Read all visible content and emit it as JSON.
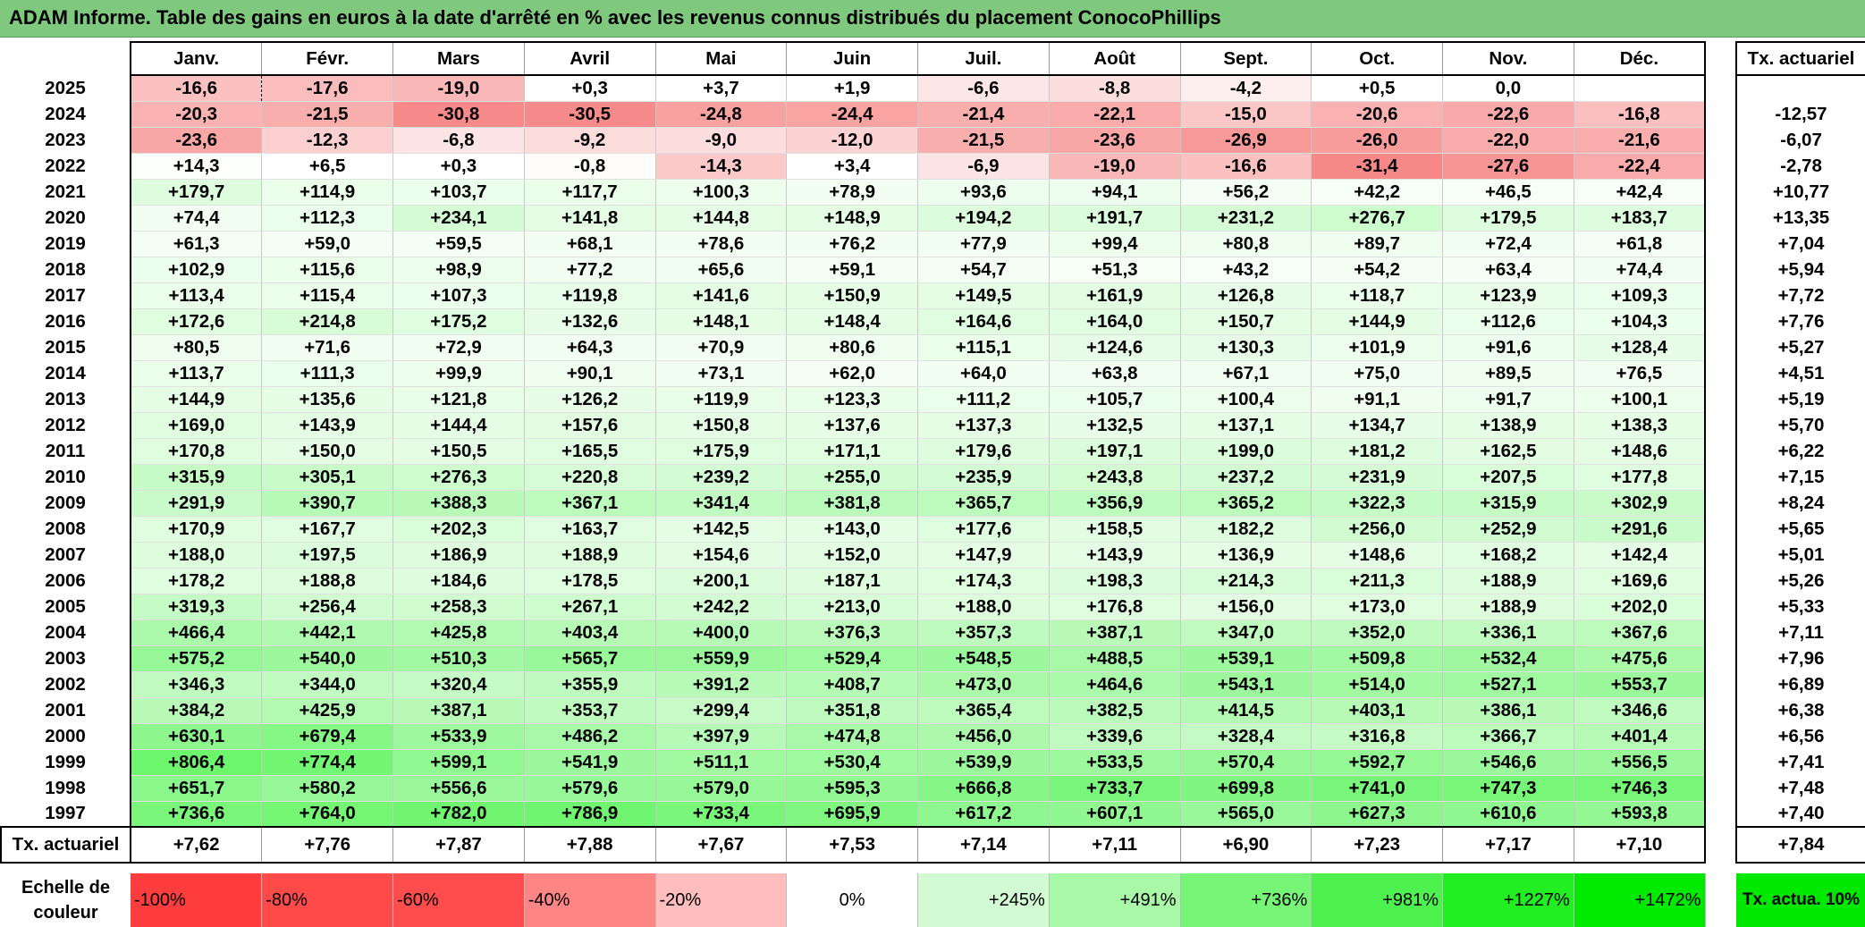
{
  "title": "ADAM Informe. Table des gains en euros à la date d'arrêté en % avec les revenus connus distribués du placement ConocoPhillips",
  "months": [
    "Janv.",
    "Févr.",
    "Mars",
    "Avril",
    "Mai",
    "Juin",
    "Juil.",
    "Août",
    "Sept.",
    "Oct.",
    "Nov.",
    "Déc."
  ],
  "side_header": "Tx. actuariel",
  "rows": [
    {
      "year": "2025",
      "values": [
        "-16,6",
        "-17,6",
        "-19,0",
        "+0,3",
        "+3,7",
        "+1,9",
        "-6,6",
        "-8,8",
        "-4,2",
        "+0,5",
        "0,0",
        ""
      ],
      "rate": ""
    },
    {
      "year": "2024",
      "values": [
        "-20,3",
        "-21,5",
        "-30,8",
        "-30,5",
        "-24,8",
        "-24,4",
        "-21,4",
        "-22,1",
        "-15,0",
        "-20,6",
        "-22,6",
        "-16,8"
      ],
      "rate": "-12,57"
    },
    {
      "year": "2023",
      "values": [
        "-23,6",
        "-12,3",
        "-6,8",
        "-9,2",
        "-9,0",
        "-12,0",
        "-21,5",
        "-23,6",
        "-26,9",
        "-26,0",
        "-22,0",
        "-21,6"
      ],
      "rate": "-6,07"
    },
    {
      "year": "2022",
      "values": [
        "+14,3",
        "+6,5",
        "+0,3",
        "-0,8",
        "-14,3",
        "+3,4",
        "-6,9",
        "-19,0",
        "-16,6",
        "-31,4",
        "-27,6",
        "-22,4"
      ],
      "rate": "-2,78"
    },
    {
      "year": "2021",
      "values": [
        "+179,7",
        "+114,9",
        "+103,7",
        "+117,7",
        "+100,3",
        "+78,9",
        "+93,6",
        "+94,1",
        "+56,2",
        "+42,2",
        "+46,5",
        "+42,4"
      ],
      "rate": "+10,77"
    },
    {
      "year": "2020",
      "values": [
        "+74,4",
        "+112,3",
        "+234,1",
        "+141,8",
        "+144,8",
        "+148,9",
        "+194,2",
        "+191,7",
        "+231,2",
        "+276,7",
        "+179,5",
        "+183,7"
      ],
      "rate": "+13,35"
    },
    {
      "year": "2019",
      "values": [
        "+61,3",
        "+59,0",
        "+59,5",
        "+68,1",
        "+78,6",
        "+76,2",
        "+77,9",
        "+99,4",
        "+80,8",
        "+89,7",
        "+72,4",
        "+61,8"
      ],
      "rate": "+7,04"
    },
    {
      "year": "2018",
      "values": [
        "+102,9",
        "+115,6",
        "+98,9",
        "+77,2",
        "+65,6",
        "+59,1",
        "+54,7",
        "+51,3",
        "+43,2",
        "+54,2",
        "+63,4",
        "+74,4"
      ],
      "rate": "+5,94"
    },
    {
      "year": "2017",
      "values": [
        "+113,4",
        "+115,4",
        "+107,3",
        "+119,8",
        "+141,6",
        "+150,9",
        "+149,5",
        "+161,9",
        "+126,8",
        "+118,7",
        "+123,9",
        "+109,3"
      ],
      "rate": "+7,72"
    },
    {
      "year": "2016",
      "values": [
        "+172,6",
        "+214,8",
        "+175,2",
        "+132,6",
        "+148,1",
        "+148,4",
        "+164,6",
        "+164,0",
        "+150,7",
        "+144,9",
        "+112,6",
        "+104,3"
      ],
      "rate": "+7,76"
    },
    {
      "year": "2015",
      "values": [
        "+80,5",
        "+71,6",
        "+72,9",
        "+64,3",
        "+70,9",
        "+80,6",
        "+115,1",
        "+124,6",
        "+130,3",
        "+101,9",
        "+91,6",
        "+128,4"
      ],
      "rate": "+5,27"
    },
    {
      "year": "2014",
      "values": [
        "+113,7",
        "+111,3",
        "+99,9",
        "+90,1",
        "+73,1",
        "+62,0",
        "+64,0",
        "+63,8",
        "+67,1",
        "+75,0",
        "+89,5",
        "+76,5"
      ],
      "rate": "+4,51"
    },
    {
      "year": "2013",
      "values": [
        "+144,9",
        "+135,6",
        "+121,8",
        "+126,2",
        "+119,9",
        "+123,3",
        "+111,2",
        "+105,7",
        "+100,4",
        "+91,1",
        "+91,7",
        "+100,1"
      ],
      "rate": "+5,19"
    },
    {
      "year": "2012",
      "values": [
        "+169,0",
        "+143,9",
        "+144,4",
        "+157,6",
        "+150,8",
        "+137,6",
        "+137,3",
        "+132,5",
        "+137,1",
        "+134,7",
        "+138,9",
        "+138,3"
      ],
      "rate": "+5,70"
    },
    {
      "year": "2011",
      "values": [
        "+170,8",
        "+150,0",
        "+150,5",
        "+165,5",
        "+175,9",
        "+171,1",
        "+179,6",
        "+197,1",
        "+199,0",
        "+181,2",
        "+162,5",
        "+148,6"
      ],
      "rate": "+6,22"
    },
    {
      "year": "2010",
      "values": [
        "+315,9",
        "+305,1",
        "+276,3",
        "+220,8",
        "+239,2",
        "+255,0",
        "+235,9",
        "+243,8",
        "+237,2",
        "+231,9",
        "+207,5",
        "+177,8"
      ],
      "rate": "+7,15"
    },
    {
      "year": "2009",
      "values": [
        "+291,9",
        "+390,7",
        "+388,3",
        "+367,1",
        "+341,4",
        "+381,8",
        "+365,7",
        "+356,9",
        "+365,2",
        "+322,3",
        "+315,9",
        "+302,9"
      ],
      "rate": "+8,24"
    },
    {
      "year": "2008",
      "values": [
        "+170,9",
        "+167,7",
        "+202,3",
        "+163,7",
        "+142,5",
        "+143,0",
        "+177,6",
        "+158,5",
        "+182,2",
        "+256,0",
        "+252,9",
        "+291,6"
      ],
      "rate": "+5,65"
    },
    {
      "year": "2007",
      "values": [
        "+188,0",
        "+197,5",
        "+186,9",
        "+188,9",
        "+154,6",
        "+152,0",
        "+147,9",
        "+143,9",
        "+136,9",
        "+148,6",
        "+168,2",
        "+142,4"
      ],
      "rate": "+5,01"
    },
    {
      "year": "2006",
      "values": [
        "+178,2",
        "+188,8",
        "+184,6",
        "+178,5",
        "+200,1",
        "+187,1",
        "+174,3",
        "+198,3",
        "+214,3",
        "+211,3",
        "+188,9",
        "+169,6"
      ],
      "rate": "+5,26"
    },
    {
      "year": "2005",
      "values": [
        "+319,3",
        "+256,4",
        "+258,3",
        "+267,1",
        "+242,2",
        "+213,0",
        "+188,0",
        "+176,8",
        "+156,0",
        "+173,0",
        "+188,9",
        "+202,0"
      ],
      "rate": "+5,33"
    },
    {
      "year": "2004",
      "values": [
        "+466,4",
        "+442,1",
        "+425,8",
        "+403,4",
        "+400,0",
        "+376,3",
        "+357,3",
        "+387,1",
        "+347,0",
        "+352,0",
        "+336,1",
        "+367,6"
      ],
      "rate": "+7,11"
    },
    {
      "year": "2003",
      "values": [
        "+575,2",
        "+540,0",
        "+510,3",
        "+565,7",
        "+559,9",
        "+529,4",
        "+548,5",
        "+488,5",
        "+539,1",
        "+509,8",
        "+532,4",
        "+475,6"
      ],
      "rate": "+7,96"
    },
    {
      "year": "2002",
      "values": [
        "+346,3",
        "+344,0",
        "+320,4",
        "+355,9",
        "+391,2",
        "+408,7",
        "+473,0",
        "+464,6",
        "+543,1",
        "+514,0",
        "+527,1",
        "+553,7"
      ],
      "rate": "+6,89"
    },
    {
      "year": "2001",
      "values": [
        "+384,2",
        "+425,9",
        "+387,1",
        "+353,7",
        "+299,4",
        "+351,8",
        "+365,4",
        "+382,5",
        "+414,5",
        "+403,1",
        "+386,1",
        "+346,6"
      ],
      "rate": "+6,38"
    },
    {
      "year": "2000",
      "values": [
        "+630,1",
        "+679,4",
        "+533,9",
        "+486,2",
        "+397,9",
        "+474,8",
        "+456,0",
        "+339,6",
        "+328,4",
        "+316,8",
        "+366,7",
        "+401,4"
      ],
      "rate": "+6,56"
    },
    {
      "year": "1999",
      "values": [
        "+806,4",
        "+774,4",
        "+599,1",
        "+541,9",
        "+511,1",
        "+530,4",
        "+539,9",
        "+533,5",
        "+570,4",
        "+592,7",
        "+546,6",
        "+556,5"
      ],
      "rate": "+7,41"
    },
    {
      "year": "1998",
      "values": [
        "+651,7",
        "+580,2",
        "+556,6",
        "+579,6",
        "+579,0",
        "+595,3",
        "+666,8",
        "+733,7",
        "+699,8",
        "+741,0",
        "+747,3",
        "+746,3"
      ],
      "rate": "+7,48"
    },
    {
      "year": "1997",
      "values": [
        "+736,6",
        "+764,0",
        "+782,0",
        "+786,9",
        "+733,4",
        "+695,9",
        "+617,2",
        "+607,1",
        "+565,0",
        "+627,3",
        "+610,6",
        "+593,8"
      ],
      "rate": "+7,40"
    }
  ],
  "footer": {
    "label": "Tx. actuariel",
    "values": [
      "+7,62",
      "+7,76",
      "+7,87",
      "+7,88",
      "+7,67",
      "+7,53",
      "+7,14",
      "+7,11",
      "+6,90",
      "+7,23",
      "+7,17",
      "+7,10"
    ],
    "overall": "+7,84"
  },
  "scale": {
    "label": "Echelle de couleur",
    "items": [
      {
        "text": "-100%",
        "color": "#ff3d3d",
        "align": "l"
      },
      {
        "text": "-80%",
        "color": "#ff4a4a",
        "align": "l"
      },
      {
        "text": "-60%",
        "color": "#ff4d4d",
        "align": "l"
      },
      {
        "text": "-40%",
        "color": "#ff8484",
        "align": "l"
      },
      {
        "text": "-20%",
        "color": "#ffbdbd",
        "align": "l"
      },
      {
        "text": "0%",
        "color": "#ffffff",
        "align": "c"
      },
      {
        "text": "+245%",
        "color": "#d3fbd3",
        "align": "r"
      },
      {
        "text": "+491%",
        "color": "#a8f8a8",
        "align": "r"
      },
      {
        "text": "+736%",
        "color": "#76f576",
        "align": "r"
      },
      {
        "text": "+981%",
        "color": "#4ef24e",
        "align": "r"
      },
      {
        "text": "+1227%",
        "color": "#22ee22",
        "align": "r"
      },
      {
        "text": "+1472%",
        "color": "#00ea00",
        "align": "r"
      }
    ],
    "legend": "Tx. actua. 10%"
  }
}
